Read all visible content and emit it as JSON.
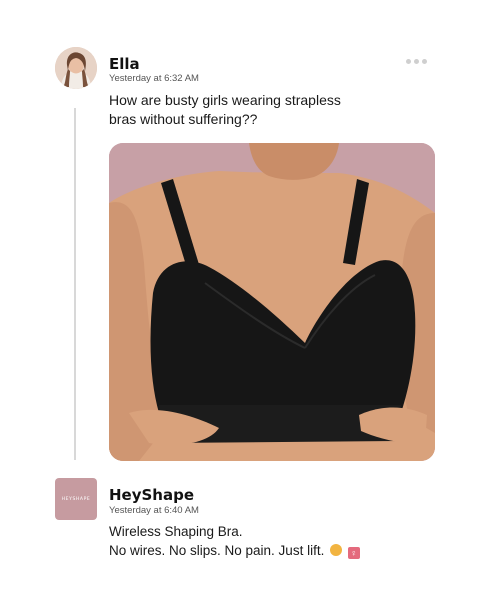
{
  "post": {
    "author": "Ella",
    "timestamp": "Yesterday at 6:32 AM",
    "text_lines": [
      "How are busty girls wearing strapless",
      "bras without suffering??"
    ],
    "menu_icon": "more-horizontal-icon",
    "image": "photo of a woman wearing a black wireless bra against a mauve background"
  },
  "reply": {
    "author": "HeyShape",
    "avatar_text": "HEYSHAPE",
    "timestamp": "Yesterday at 6:40 AM",
    "text_lines": [
      "Wireless Shaping Bra.",
      "No wires. No slips. No pain. Just lift."
    ],
    "emoji_icons": [
      "person-gesturing-icon",
      "female-sign-icon"
    ]
  },
  "colors": {
    "background": "#ffffff",
    "thread_line": "#d8d8d8",
    "brand_avatar": "#c69ba0",
    "photo_background": "#c7a0a6",
    "bra": "#161616"
  }
}
